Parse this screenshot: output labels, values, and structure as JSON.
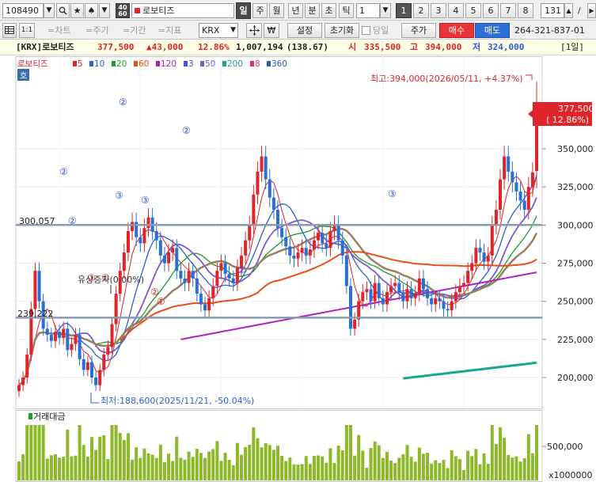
{
  "toolbar": {
    "code": "108490",
    "mini_label": "40\n60",
    "stock_name": "로보티즈",
    "periods": [
      "일",
      "주",
      "월",
      "년",
      "분",
      "초",
      "틱"
    ],
    "period_num": "1",
    "pages": [
      "1",
      "2",
      "3",
      "4",
      "5",
      "6",
      "7",
      "8"
    ],
    "count": "131",
    "slash": "/"
  },
  "toolbar2": {
    "ratio": "1:1",
    "chart_btn": "=차트",
    "cycle_btn": "=주기",
    "range_btn": "=기간",
    "index_btn": "=지표",
    "market": "KRX",
    "won_icon": "₩",
    "settings": "설정",
    "reset": "초기화",
    "same_day": "당일",
    "price": "주가",
    "buy": "매수",
    "sell": "매도",
    "account": "264-321-837-01"
  },
  "info": {
    "name": "[KRX]로보티즈",
    "price": "377,500",
    "change": "▲43,000",
    "pct": "12.86%",
    "volume": "1,007,194",
    "vol_ratio": "(138.67)",
    "open_label": "시",
    "open": "335,500",
    "high_label": "고",
    "high": "394,000",
    "low_label": "저",
    "low": "324,000",
    "period": "[1일]"
  },
  "chart": {
    "marker": "호",
    "legend_name": "로보티즈",
    "ma": [
      {
        "label": "5",
        "color": "#e0242a"
      },
      {
        "label": "10",
        "color": "#2a5fd8"
      },
      {
        "label": "20",
        "color": "#1a9e2a"
      },
      {
        "label": "60",
        "color": "#e8501a"
      },
      {
        "label": "120",
        "color": "#b020c0"
      },
      {
        "label": "3",
        "color": "#3a55d8"
      },
      {
        "label": "50",
        "color": "#7a5ad0"
      },
      {
        "label": "200",
        "color": "#18a890"
      },
      {
        "label": "8",
        "color": "#d03080"
      },
      {
        "label": "360",
        "color": "#2a60b0"
      }
    ],
    "yticks": [
      "350,000",
      "325,000",
      "300,000",
      "275,000",
      "250,000",
      "225,000",
      "200,000"
    ],
    "current_price": "377,500",
    "current_pct": "( 12.86%)",
    "line1_label": "300,057",
    "line2_label": "239,222",
    "high_note": "최고:394,000(2026/05/11, +4.37%)",
    "low_note": "최저:188,600(2025/11/21, -50.04%)",
    "rights_issue": "유상증자(0.00%)",
    "wave_labels": [
      "②",
      "②",
      "③",
      "①",
      "③",
      "③",
      "②",
      "②",
      "②",
      "①",
      "②",
      "③"
    ],
    "volume_title": "거래대금",
    "vol_tick": "500,000",
    "vol_unit": "x1000000"
  },
  "chart_data": {
    "type": "candlestick",
    "title": "로보티즈",
    "ylabel": "",
    "ylim": [
      175000,
      400000
    ],
    "horizontal_lines": [
      300057,
      239222
    ],
    "series_close": [
      195000,
      200000,
      215000,
      245000,
      270000,
      250000,
      232000,
      228000,
      224000,
      230000,
      226000,
      232000,
      218000,
      222000,
      228000,
      212000,
      205000,
      210000,
      200000,
      195000,
      205000,
      215000,
      220000,
      235000,
      255000,
      270000,
      282000,
      296000,
      302000,
      292000,
      288000,
      298000,
      305000,
      296000,
      290000,
      280000,
      275000,
      282000,
      285000,
      270000,
      265000,
      262000,
      270000,
      265000,
      255000,
      248000,
      244000,
      252000,
      260000,
      270000,
      275000,
      268000,
      265000,
      262000,
      272000,
      280000,
      290000,
      300000,
      320000,
      335000,
      345000,
      330000,
      318000,
      310000,
      298000,
      292000,
      286000,
      280000,
      278000,
      282000,
      285000,
      280000,
      284000,
      290000,
      295000,
      288000,
      285000,
      296000,
      300000,
      290000,
      280000,
      260000,
      232000,
      238000,
      250000,
      256000,
      258000,
      250000,
      262000,
      252000,
      248000,
      256000,
      260000,
      262000,
      256000,
      250000,
      258000,
      252000,
      255000,
      265000,
      258000,
      252000,
      248000,
      252000,
      250000,
      245000,
      244000,
      250000,
      256000,
      260000,
      262000,
      270000,
      275000,
      285000,
      282000,
      276000,
      280000,
      300000,
      310000,
      330000,
      345000,
      335000,
      328000,
      322000,
      316000,
      310000,
      325000,
      334500,
      377500
    ],
    "volume_max_note": "500,000",
    "last": {
      "price": 377500,
      "change": 43000,
      "pct": 12.86,
      "open": 335500,
      "high": 394000,
      "low": 324000
    }
  }
}
